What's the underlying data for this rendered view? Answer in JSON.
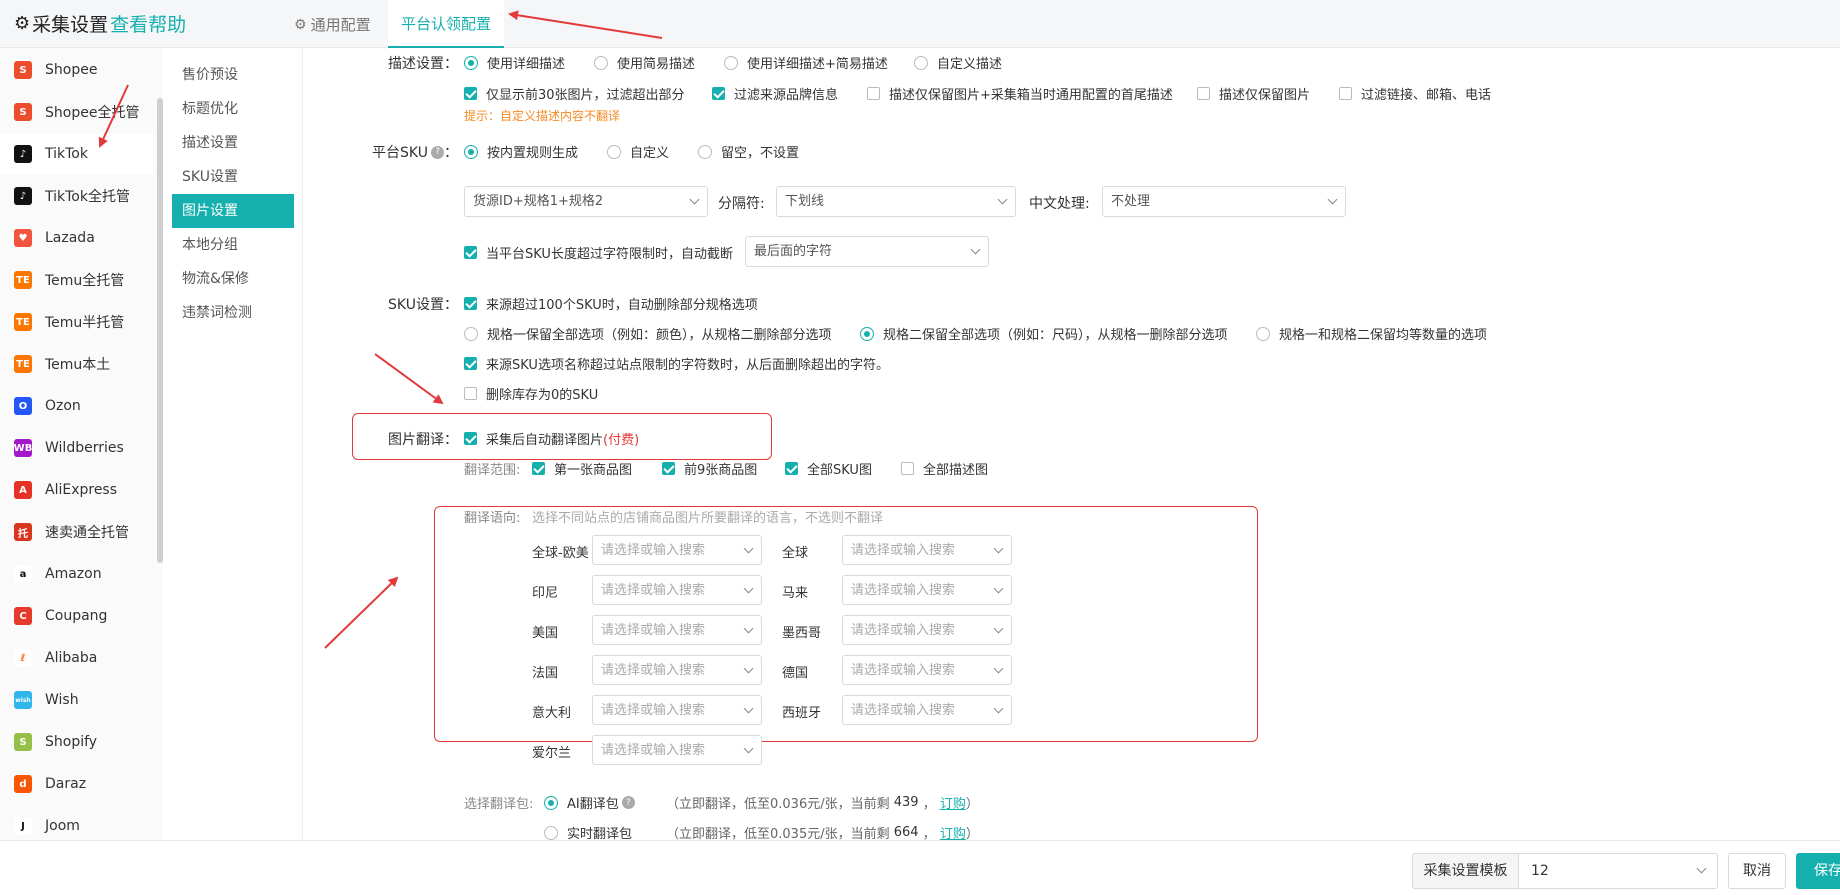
{
  "header": {
    "title": "采集设置",
    "help_link": "查看帮助",
    "tabs": [
      {
        "label": "通用配置",
        "active": false
      },
      {
        "label": "平台认领配置",
        "active": true
      }
    ]
  },
  "platforms": [
    {
      "label": "Shopee",
      "icon": "shopee-icon",
      "color": "#ee4d2d",
      "glyph": "S"
    },
    {
      "label": "Shopee全托管",
      "icon": "shopee-icon",
      "color": "#ee4d2d",
      "glyph": "S"
    },
    {
      "label": "TikTok",
      "icon": "tiktok-icon",
      "color": "#111111",
      "glyph": "♪",
      "active": true
    },
    {
      "label": "TikTok全托管",
      "icon": "tiktok-icon",
      "color": "#111111",
      "glyph": "♪"
    },
    {
      "label": "Lazada",
      "icon": "lazada-icon",
      "color": "#f2543d",
      "glyph": "♥"
    },
    {
      "label": "Temu全托管",
      "icon": "temu-icon",
      "color": "#fb7701",
      "glyph": "TE"
    },
    {
      "label": "Temu半托管",
      "icon": "temu-icon",
      "color": "#fb7701",
      "glyph": "TE"
    },
    {
      "label": "Temu本土",
      "icon": "temu-icon",
      "color": "#fb7701",
      "glyph": "TE"
    },
    {
      "label": "Ozon",
      "icon": "ozon-icon",
      "color": "#2457f5",
      "glyph": "O"
    },
    {
      "label": "Wildberries",
      "icon": "wildberries-icon",
      "color": "#a319c9",
      "glyph": "WB"
    },
    {
      "label": "AliExpress",
      "icon": "aliexpress-icon",
      "color": "#e43225",
      "glyph": "A"
    },
    {
      "label": "速卖通全托管",
      "icon": "aliexpress-choice-icon",
      "color": "#d9361f",
      "glyph": "托"
    },
    {
      "label": "Amazon",
      "icon": "amazon-icon",
      "color": "#ffffff",
      "glyph": "a",
      "fg": "#111111"
    },
    {
      "label": "Coupang",
      "icon": "coupang-icon",
      "color": "#e53a2c",
      "glyph": "C"
    },
    {
      "label": "Alibaba",
      "icon": "alibaba-icon",
      "color": "#ffffff",
      "glyph": "ℓ",
      "fg": "#ff6a00"
    },
    {
      "label": "Wish",
      "icon": "wish-icon",
      "color": "#2fb7ec",
      "glyph": "wish"
    },
    {
      "label": "Shopify",
      "icon": "shopify-icon",
      "color": "#95bf47",
      "glyph": "S"
    },
    {
      "label": "Daraz",
      "icon": "daraz-icon",
      "color": "#f85606",
      "glyph": "d"
    },
    {
      "label": "Joom",
      "icon": "joom-icon",
      "color": "#ffffff",
      "glyph": "J",
      "fg": "#111111"
    }
  ],
  "submenu": [
    {
      "label": "售价预设"
    },
    {
      "label": "标题优化"
    },
    {
      "label": "描述设置"
    },
    {
      "label": "SKU设置"
    },
    {
      "label": "图片设置",
      "active": true
    },
    {
      "label": "本地分组"
    },
    {
      "label": "物流&保修"
    },
    {
      "label": "违禁词检测"
    }
  ],
  "desc": {
    "label": "描述设置：",
    "options": [
      "使用详细描述",
      "使用简易描述",
      "使用详细描述+简易描述",
      "自定义描述"
    ],
    "selected": 0,
    "checks": [
      {
        "label": "仅显示前30张图片，过滤超出部分",
        "checked": true
      },
      {
        "label": "过滤来源品牌信息",
        "checked": true
      },
      {
        "label": "描述仅保留图片+采集箱当时通用配置的首尾描述",
        "checked": false
      },
      {
        "label": "描述仅保留图片",
        "checked": false
      },
      {
        "label": "过滤链接、邮箱、电话",
        "checked": false
      }
    ],
    "hint": "提示：自定义描述内容不翻译"
  },
  "platform_sku": {
    "label": "平台SKU",
    "options": [
      "按内置规则生成",
      "自定义",
      "留空，不设置"
    ],
    "selected": 0,
    "rule_select": "货源ID+规格1+规格2",
    "separator_label": "分隔符:",
    "separator_value": "下划线",
    "chinese_label": "中文处理:",
    "chinese_value": "不处理",
    "truncate_label": "当平台SKU长度超过字符限制时，自动截断",
    "truncate_checked": true,
    "truncate_value": "最后面的字符"
  },
  "sku_settings": {
    "label": "SKU设置：",
    "auto_delete": {
      "label": "来源超过100个SKU时，自动删除部分规格选项",
      "checked": true
    },
    "options": [
      "规格一保留全部选项（例如：颜色），从规格二删除部分选项",
      "规格二保留全部选项（例如：尺码），从规格一删除部分选项",
      "规格一和规格二保留均等数量的选项"
    ],
    "selected": 1,
    "trim_names": {
      "label": "来源SKU选项名称超过站点限制的字符数时，从后面删除超出的字符。",
      "checked": true
    },
    "delete_zero": {
      "label": "删除库存为0的SKU",
      "checked": false
    }
  },
  "image_translate": {
    "label": "图片翻译：",
    "auto": {
      "label": "采集后自动翻译图片",
      "paid": "(付费)",
      "checked": true
    },
    "scope_label": "翻译范围:",
    "scope": [
      {
        "label": "第一张商品图",
        "checked": true
      },
      {
        "label": "前9张商品图",
        "checked": true
      },
      {
        "label": "全部SKU图",
        "checked": true
      },
      {
        "label": "全部描述图",
        "checked": false
      }
    ],
    "lang_label": "翻译语向:",
    "lang_hint": "选择不同站点的店铺商品图片所要翻译的语言，不选则不翻译",
    "placeholder": "请选择或输入搜索",
    "sites_left": [
      "全球-欧美",
      "印尼",
      "美国",
      "法国",
      "意大利",
      "爱尔兰"
    ],
    "sites_right": [
      "全球",
      "马来",
      "墨西哥",
      "德国",
      "西班牙"
    ],
    "pack_label": "选择翻译包:",
    "packs": [
      {
        "name": "AI翻译包",
        "desc_pre": "（立即翻译，低至0.036元/张，当前剩",
        "remain": "439",
        "buy": "订购",
        "close": "）",
        "selected": true
      },
      {
        "name": "实时翻译包",
        "desc_pre": "（立即翻译，低至0.035元/张，当前剩",
        "remain": "664",
        "buy": "订购",
        "close": "）",
        "selected": false
      }
    ]
  },
  "footer": {
    "template_label": "采集设置模板",
    "template_value": "12",
    "cancel": "取消",
    "save": "保存"
  }
}
